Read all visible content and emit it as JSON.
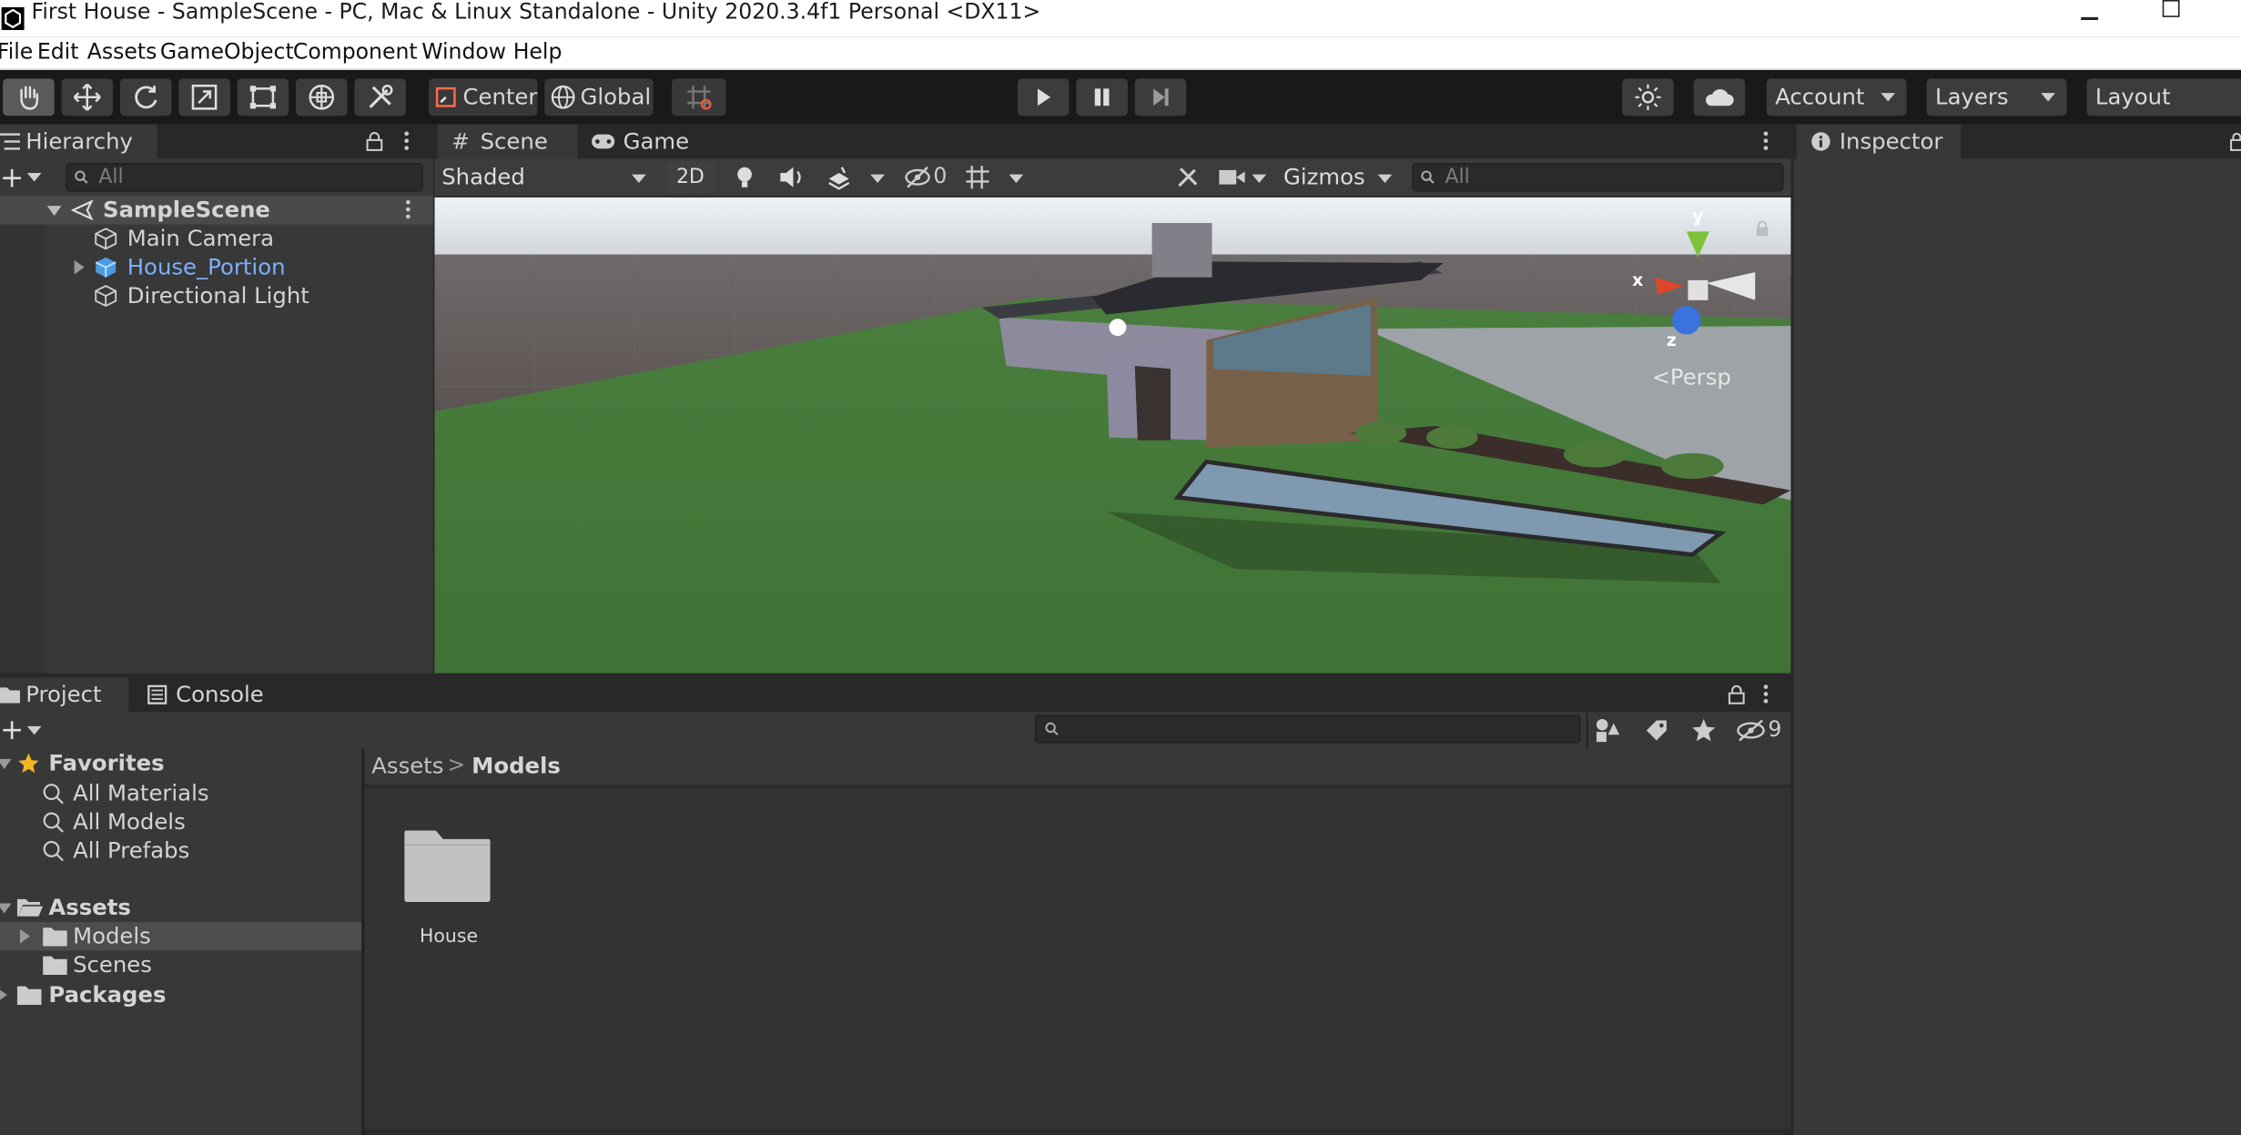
{
  "window": {
    "title": "First House - SampleScene - PC, Mac & Linux Standalone - Unity 2020.3.4f1 Personal <DX11>"
  },
  "menu": [
    "File",
    "Edit",
    "Assets",
    "GameObject",
    "Component",
    "Window",
    "Help"
  ],
  "toolbar": {
    "pivot_label": "Center",
    "space_label": "Global",
    "account_label": "Account",
    "layers_label": "Layers",
    "layout_label": "Layout"
  },
  "hierarchy": {
    "tab_label": "Hierarchy",
    "search_placeholder": "All",
    "scene_name": "SampleScene",
    "items": [
      "Main Camera",
      "House_Portion",
      "Directional Light"
    ]
  },
  "scene": {
    "tabs": [
      "Scene",
      "Game"
    ],
    "shading_mode": "Shaded",
    "mode_2d": "2D",
    "hidden_count": "0",
    "gizmos_label": "Gizmos",
    "search_placeholder": "All",
    "persp_label": "Persp",
    "axis_labels": {
      "x": "x",
      "y": "y",
      "z": "z"
    }
  },
  "inspector": {
    "tab_label": "Inspector"
  },
  "project": {
    "tabs": [
      "Project",
      "Console"
    ],
    "hidden_count": "9",
    "favorites_label": "Favorites",
    "favorites": [
      "All Materials",
      "All Models",
      "All Prefabs"
    ],
    "assets_label": "Assets",
    "asset_folders": [
      "Models",
      "Scenes"
    ],
    "packages_label": "Packages",
    "breadcrumb": [
      "Assets",
      "Models"
    ],
    "grid_items": [
      "House"
    ]
  },
  "colors": {
    "accent_blue": "#7bb0ff",
    "editor_bg": "#383838",
    "selected_row": "#4d4d4d"
  }
}
